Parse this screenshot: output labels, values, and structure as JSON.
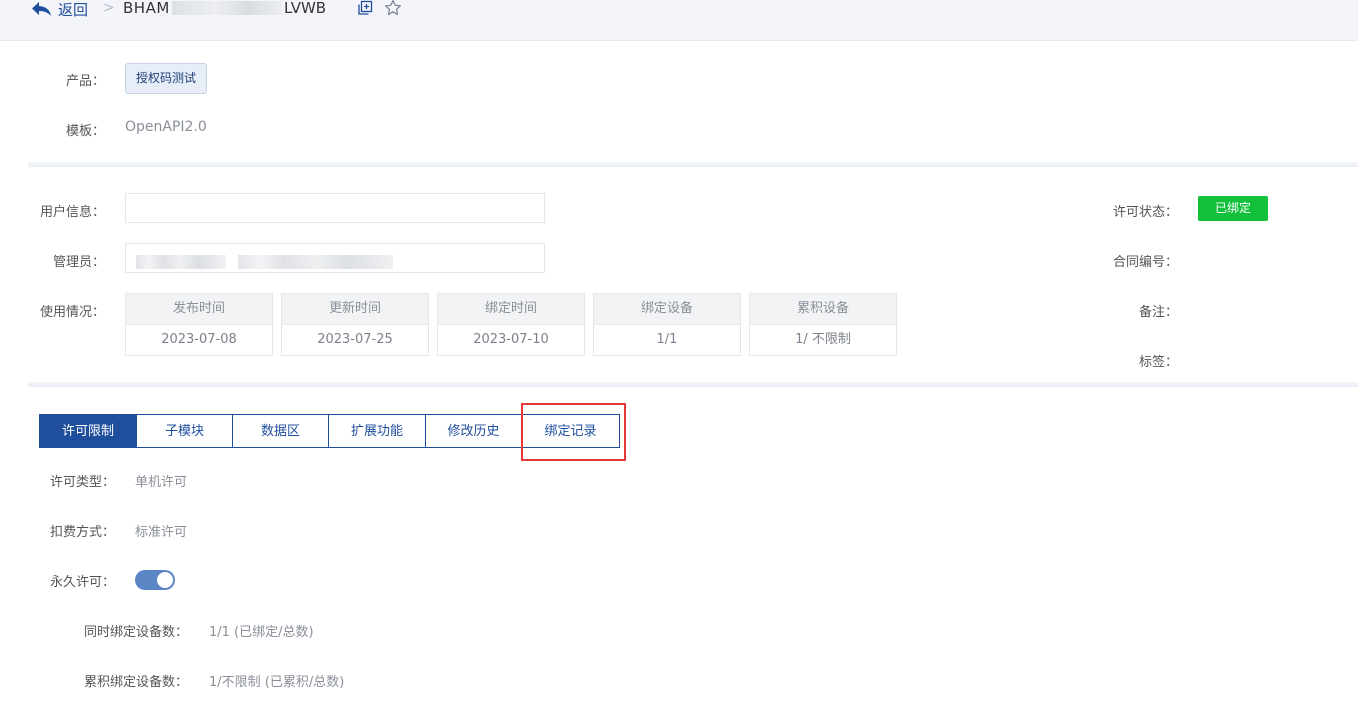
{
  "header": {
    "back_label": "返回",
    "separator": ">",
    "title_prefix": "BHAM",
    "title_suffix": "LVWB"
  },
  "product": {
    "label": "产品：",
    "tag": "授权码测试"
  },
  "template": {
    "label": "模板：",
    "value": "OpenAPI2.0"
  },
  "user_info": {
    "label": "用户信息：",
    "value": ""
  },
  "admin": {
    "label": "管理员："
  },
  "usage": {
    "label": "使用情况：",
    "columns": [
      {
        "header": "发布时间",
        "value": "2023-07-08"
      },
      {
        "header": "更新时间",
        "value": "2023-07-25"
      },
      {
        "header": "绑定时间",
        "value": "2023-07-10"
      },
      {
        "header": "绑定设备",
        "value": "1/1"
      },
      {
        "header": "累积设备",
        "value": "1/ 不限制"
      }
    ]
  },
  "right_panel": {
    "status_label": "许可状态：",
    "status_badge": "已绑定",
    "status_color": "#13c03b",
    "contract_label": "合同编号：",
    "remark_label": "备注：",
    "tag_label": "标签："
  },
  "tabs": [
    {
      "label": "许可限制",
      "active": true
    },
    {
      "label": "子模块",
      "active": false
    },
    {
      "label": "数据区",
      "active": false
    },
    {
      "label": "扩展功能",
      "active": false
    },
    {
      "label": "修改历史",
      "active": false
    },
    {
      "label": "绑定记录",
      "active": false
    }
  ],
  "license": {
    "type_label": "许可类型：",
    "type_value": "单机许可",
    "billing_label": "扣费方式：",
    "billing_value": "标准许可",
    "permanent_label": "永久许可：",
    "permanent_on": true,
    "concurrent_label": "同时绑定设备数：",
    "concurrent_value": "1/1 (已绑定/总数)",
    "cumulative_label": "累积绑定设备数：",
    "cumulative_value": "1/不限制 (已累积/总数)"
  },
  "colors": {
    "accent": "#1f4e9d",
    "highlight": "#e53935"
  }
}
